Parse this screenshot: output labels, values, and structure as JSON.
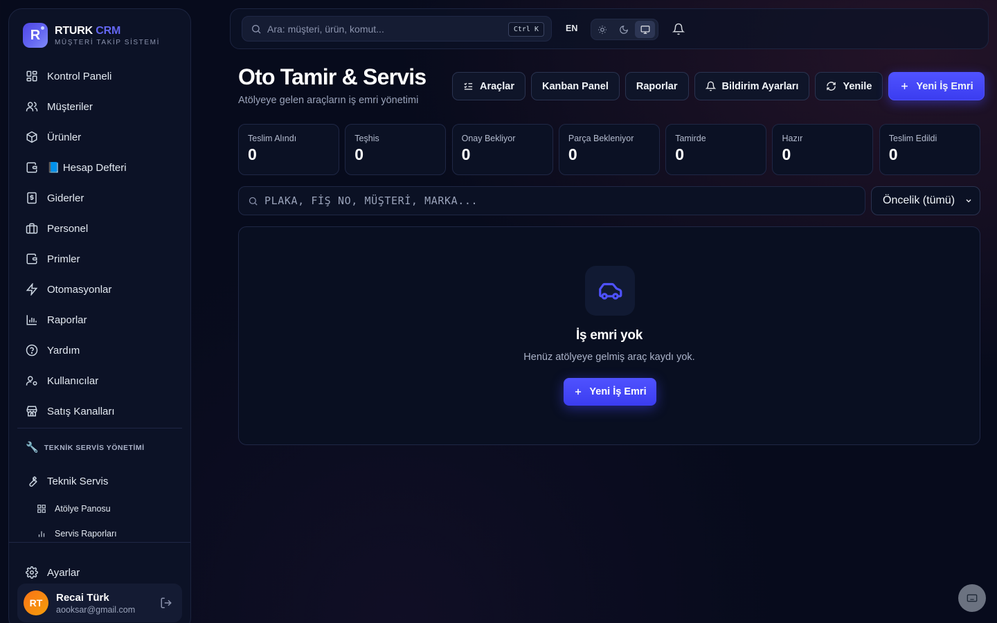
{
  "brand": {
    "name_main": "RTURK",
    "name_accent": "CRM",
    "subtitle": "MÜŞTERİ TAKİP SİSTEMİ",
    "logo_letter": "R"
  },
  "sidebar": {
    "items": [
      {
        "label": "Kontrol Paneli",
        "icon": "dashboard-icon"
      },
      {
        "label": "Müşteriler",
        "icon": "users-icon"
      },
      {
        "label": "Ürünler",
        "icon": "package-icon"
      },
      {
        "label": "📘 Hesap Defteri",
        "icon": "wallet-icon"
      },
      {
        "label": "Giderler",
        "icon": "receipt-icon"
      },
      {
        "label": "Personel",
        "icon": "briefcase-icon"
      },
      {
        "label": "Primler",
        "icon": "wallet-icon"
      },
      {
        "label": "Otomasyonlar",
        "icon": "zap-icon"
      },
      {
        "label": "Raporlar",
        "icon": "bar-chart-icon"
      },
      {
        "label": "Yardım",
        "icon": "help-icon"
      },
      {
        "label": "Kullanıcılar",
        "icon": "user-cog-icon"
      },
      {
        "label": "Satış Kanalları",
        "icon": "store-icon"
      }
    ],
    "section_title": "TEKNİK SERVİS YÖNETİMİ",
    "section_item": "Teknik Servis",
    "sub_items": [
      {
        "label": "Atölye Panosu",
        "icon": "grid-icon"
      },
      {
        "label": "Servis Raporları",
        "icon": "bar-chart-icon"
      }
    ],
    "settings_label": "Ayarlar"
  },
  "user": {
    "initials": "RT",
    "name": "Recai Türk",
    "email": "aooksar@gmail.com"
  },
  "topbar": {
    "search_placeholder": "Ara: müşteri, ürün, komut...",
    "shortcut": "Ctrl K",
    "language": "EN",
    "theme_active": "system"
  },
  "header": {
    "title": "Oto Tamir & Servis",
    "subtitle": "Atölyeye gelen araçların iş emri yönetimi"
  },
  "actions": [
    {
      "label": "Araçlar",
      "icon": "list-check-icon"
    },
    {
      "label": "Kanban Panel",
      "icon": ""
    },
    {
      "label": "Raporlar",
      "icon": ""
    },
    {
      "label": "Bildirim Ayarları",
      "icon": "bell-icon"
    },
    {
      "label": "Yenile",
      "icon": "refresh-icon"
    },
    {
      "label": "Yeni İş Emri",
      "icon": "plus-icon"
    }
  ],
  "stats": [
    {
      "label": "Teslim Alındı",
      "value": "0"
    },
    {
      "label": "Teşhis",
      "value": "0"
    },
    {
      "label": "Onay Bekliyor",
      "value": "0"
    },
    {
      "label": "Parça Bekleniyor",
      "value": "0"
    },
    {
      "label": "Tamirde",
      "value": "0"
    },
    {
      "label": "Hazır",
      "value": "0"
    },
    {
      "label": "Teslim Edildi",
      "value": "0"
    }
  ],
  "filter": {
    "placeholder": "PLAKA, FİŞ NO, MÜŞTERİ, MARKA...",
    "priority_selected": "Öncelik (tümü)"
  },
  "empty_state": {
    "title": "İş emri yok",
    "subtitle": "Henüz atölyeye gelmiş araç kaydı yok.",
    "button": "Yeni İş Emri",
    "icon": "car-icon"
  },
  "colors": {
    "accent": "#4f52ff",
    "background": "#070b1c",
    "panel": "#0c1226",
    "avatar": "#f97316"
  }
}
